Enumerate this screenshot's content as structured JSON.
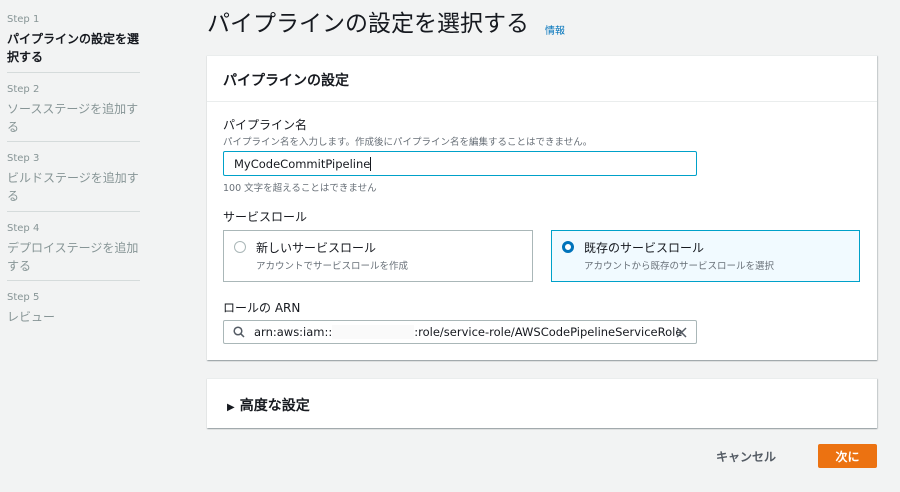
{
  "sidebar": {
    "steps": [
      {
        "num": "Step 1",
        "label": "パイプラインの設定を選択する",
        "active": true
      },
      {
        "num": "Step 2",
        "label": "ソースステージを追加する"
      },
      {
        "num": "Step 3",
        "label": "ビルドステージを追加する"
      },
      {
        "num": "Step 4",
        "label": "デプロイステージを追加する"
      },
      {
        "num": "Step 5",
        "label": "レビュー"
      }
    ]
  },
  "header": {
    "title": "パイプラインの設定を選択する",
    "info_link": "情報"
  },
  "settings": {
    "title": "パイプラインの設定",
    "name_label": "パイプライン名",
    "name_desc": "パイプライン名を入力します。作成後にパイプライン名を編集することはできません。",
    "name_value": "MyCodeCommitPipeline",
    "name_hint": "100 文字を超えることはできません",
    "role_label": "サービスロール",
    "role_options": [
      {
        "title": "新しいサービスロール",
        "desc": "アカウントでサービスロールを作成",
        "selected": false
      },
      {
        "title": "既存のサービスロール",
        "desc": "アカウントから既存のサービスロールを選択",
        "selected": true
      }
    ],
    "arn_label": "ロールの ARN",
    "arn_prefix": "arn:aws:iam::",
    "arn_suffix": ":role/service-role/AWSCodePipelineServiceRole"
  },
  "advanced": {
    "title": "高度な設定"
  },
  "footer": {
    "cancel": "キャンセル",
    "next": "次に"
  },
  "colors": {
    "accent": "#ec7211",
    "link": "#0073bb",
    "selected_bg": "#f1faff",
    "selected_border": "#00a1c9"
  }
}
